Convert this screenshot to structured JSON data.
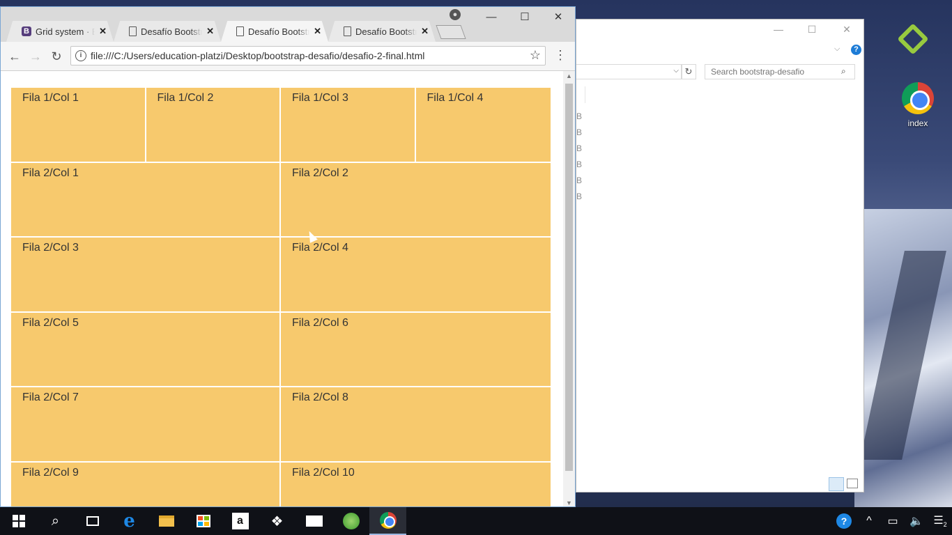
{
  "browser": {
    "tabs": [
      {
        "title": "Grid system · Bo",
        "favicon": "bootstrap-icon",
        "active": false
      },
      {
        "title": "Desafío Bootstrap",
        "favicon": "document-icon",
        "active": false
      },
      {
        "title": "Desafío Bootstrap",
        "favicon": "document-icon",
        "active": true
      },
      {
        "title": "Desafío Bootstrap",
        "favicon": "document-icon",
        "active": false
      }
    ],
    "url": "file:///C:/Users/education-platzi/Desktop/bootstrap-desafio/desafio-2-final.html",
    "window_controls": {
      "minimize": "—",
      "maximize": "☐",
      "close": "✕"
    }
  },
  "page": {
    "rows": [
      {
        "cols": [
          "Fila 1/Col 1",
          "Fila 1/Col 2",
          "Fila 1/Col 3",
          "Fila 1/Col 4"
        ]
      },
      {
        "cols": [
          "Fila 2/Col 1",
          "Fila 2/Col 2"
        ]
      },
      {
        "cols": [
          "Fila 2/Col 3",
          "Fila 2/Col 4"
        ]
      },
      {
        "cols": [
          "Fila 2/Col 5",
          "Fila 2/Col 6"
        ]
      },
      {
        "cols": [
          "Fila 2/Col 7",
          "Fila 2/Col 8"
        ]
      },
      {
        "cols": [
          "Fila 2/Col 9",
          "Fila 2/Col 10"
        ]
      }
    ],
    "cell_color": "#f7c96d"
  },
  "explorer": {
    "search_placeholder": "Search bootstrap-desafio",
    "list_fragments": [
      "B",
      "B",
      "B",
      "B",
      "B",
      "B"
    ]
  },
  "desktop": {
    "chrome_icon_label": "index"
  },
  "taskbar": {
    "notification_count": "2"
  }
}
